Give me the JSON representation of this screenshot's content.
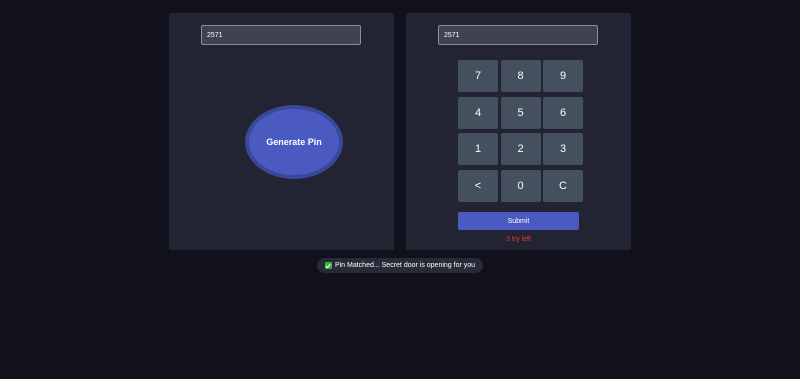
{
  "generator": {
    "pin_value": "2571",
    "generate_label": "Generate Pin"
  },
  "matcher": {
    "typed_value": "2571",
    "keys": [
      "7",
      "8",
      "9",
      "4",
      "5",
      "6",
      "1",
      "2",
      "3",
      "<",
      "0",
      "C"
    ],
    "submit_label": "Submit",
    "tries_left_text": "3 try left"
  },
  "notification": {
    "text": "Pin Matched... Secret door is opening for you",
    "icon": "check-icon",
    "success_color": "#3cb043"
  },
  "colors": {
    "accent": "#4a5ac0",
    "error": "#e8363d"
  }
}
